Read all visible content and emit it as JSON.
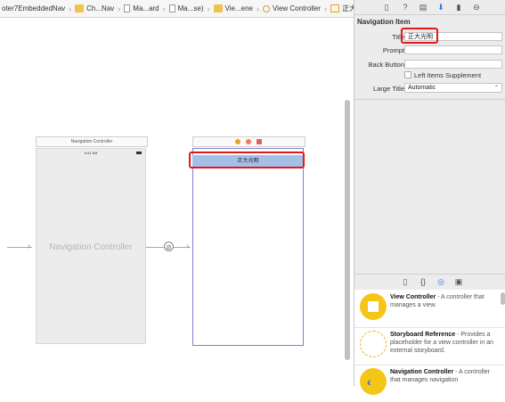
{
  "breadcrumbs": [
    {
      "label": "oter7EmbeddedNav",
      "icon": "project-folder-icon"
    },
    {
      "label": "Ch...Nav",
      "icon": "folder-icon"
    },
    {
      "label": "Ma...ard",
      "icon": "storyboard-file-icon"
    },
    {
      "label": "Ma...se)",
      "icon": "storyboard-file-icon"
    },
    {
      "label": "Vie...ene",
      "icon": "scene-folder-icon"
    },
    {
      "label": "View Controller",
      "icon": "view-controller-icon"
    },
    {
      "label": "正大光明",
      "icon": "navigation-item-icon"
    }
  ],
  "canvas": {
    "nav_scene_label": "Navigation Controller",
    "nav_scene_title": "Navigation Controller",
    "status_time": "9:41 AM",
    "vc_navbar_title": "正大光明"
  },
  "inspector": {
    "section_title": "Navigation Item",
    "title_label": "Title",
    "title_value": "正大光明",
    "prompt_label": "Prompt",
    "prompt_value": "",
    "back_button_label": "Back Button",
    "back_button_value": "",
    "left_items_supplement_label": "Left Items Supplement",
    "left_items_supplement_checked": false,
    "large_title_label": "Large Title",
    "large_title_value": "Automatic"
  },
  "library": {
    "items": [
      {
        "name": "View Controller",
        "description": "- A controller that manages a view.",
        "icon_color": "#f5c518"
      },
      {
        "name": "Storyboard Reference",
        "description": "- Provides a placeholder for a view controller in an external storyboard.",
        "icon_color": "#f5c518"
      },
      {
        "name": "Navigation Controller",
        "description": "- A controller that manages navigation",
        "icon_color": "#f5c518"
      }
    ]
  },
  "colors": {
    "highlight": "#e01919",
    "navbar_fill": "#a6bfe8",
    "accent": "#2e7be6"
  }
}
